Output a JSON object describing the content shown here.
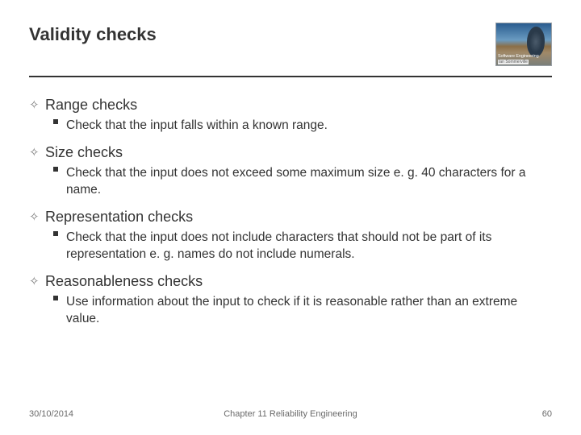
{
  "title": "Validity checks",
  "logo": {
    "label": "Software Engineering",
    "author": "Ian Sommerville"
  },
  "items": [
    {
      "heading": "Range checks",
      "sub": [
        "Check that the input falls within a known range."
      ]
    },
    {
      "heading": "Size checks",
      "sub": [
        "Check that the input does not exceed some maximum size e. g. 40 characters for a name."
      ]
    },
    {
      "heading": "Representation checks",
      "sub": [
        "Check that the input does not include characters that should not be part of its representation e. g. names do not include numerals."
      ]
    },
    {
      "heading": "Reasonableness checks",
      "sub": [
        "Use information about the input to check if it is reasonable rather than an extreme value."
      ]
    }
  ],
  "footer": {
    "date": "30/10/2014",
    "chapter": "Chapter 11 Reliability Engineering",
    "page": "60"
  }
}
